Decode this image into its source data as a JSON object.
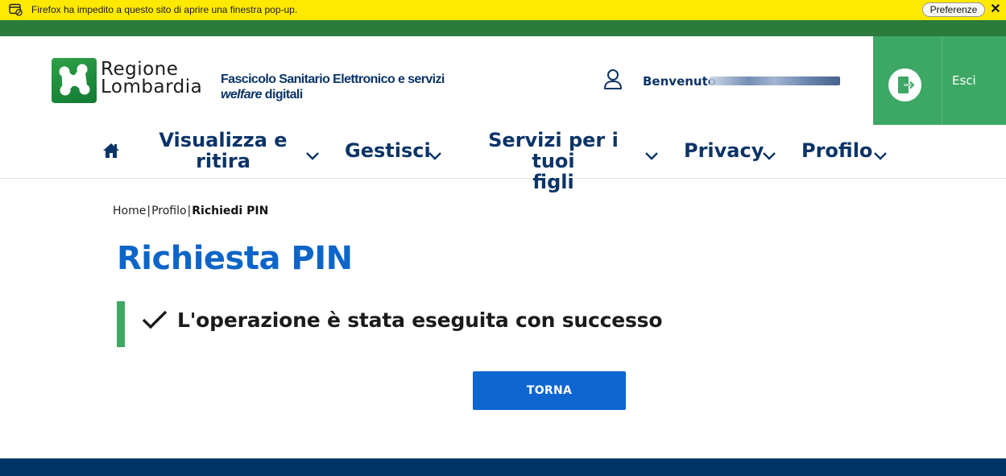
{
  "browser_notification": {
    "icon": "popup-blocked-icon",
    "message": "Firefox ha impedito a questo sito di aprire una finestra pop-up.",
    "preferences_label": "Preferenze",
    "close_icon": "close-icon"
  },
  "header": {
    "logo": {
      "icon": "regione-lombardia-logo-icon",
      "line1": "Regione",
      "line2": "Lombardia"
    },
    "service_title_line1": "Fascicolo Sanitario Elettronico e servizi",
    "service_title_line2_em": "welfare",
    "service_title_line2_rest": " digitali",
    "user": {
      "icon": "user-icon",
      "welcome_label": "Benvenuto",
      "name_redacted": true
    },
    "logout": {
      "icon": "logout-door-icon",
      "label": "Esci"
    }
  },
  "nav": {
    "home_icon": "home-icon",
    "items": [
      {
        "label_line1": "Visualizza e",
        "label_line2": "ritira",
        "icon": "chevron-down-icon"
      },
      {
        "label_line1": "Gestisci",
        "label_line2": "",
        "icon": "chevron-down-icon"
      },
      {
        "label_line1": "Servizi per i tuoi",
        "label_line2": "figli",
        "icon": "chevron-down-icon"
      },
      {
        "label_line1": "Privacy",
        "label_line2": "",
        "icon": "chevron-down-icon"
      },
      {
        "label_line1": "Profilo",
        "label_line2": "",
        "icon": "chevron-down-icon"
      }
    ]
  },
  "breadcrumb": {
    "items": [
      "Home",
      "Profilo",
      "Richiedi PIN"
    ],
    "separator": "|"
  },
  "main": {
    "title": "Richiesta PIN",
    "alert": {
      "type": "success",
      "icon": "checkmark-icon",
      "message": "L'operazione è stata eseguita con successo"
    },
    "back_button_label": "TORNA"
  },
  "colors": {
    "notification_bg": "#ffe900",
    "brand_green": "#2a7b3c",
    "logout_green": "#3da765",
    "navy": "#0b3467",
    "title_blue": "#0e65c8",
    "button_blue": "#0e66d0",
    "success_green": "#3fa862",
    "footer_navy": "#003466"
  }
}
